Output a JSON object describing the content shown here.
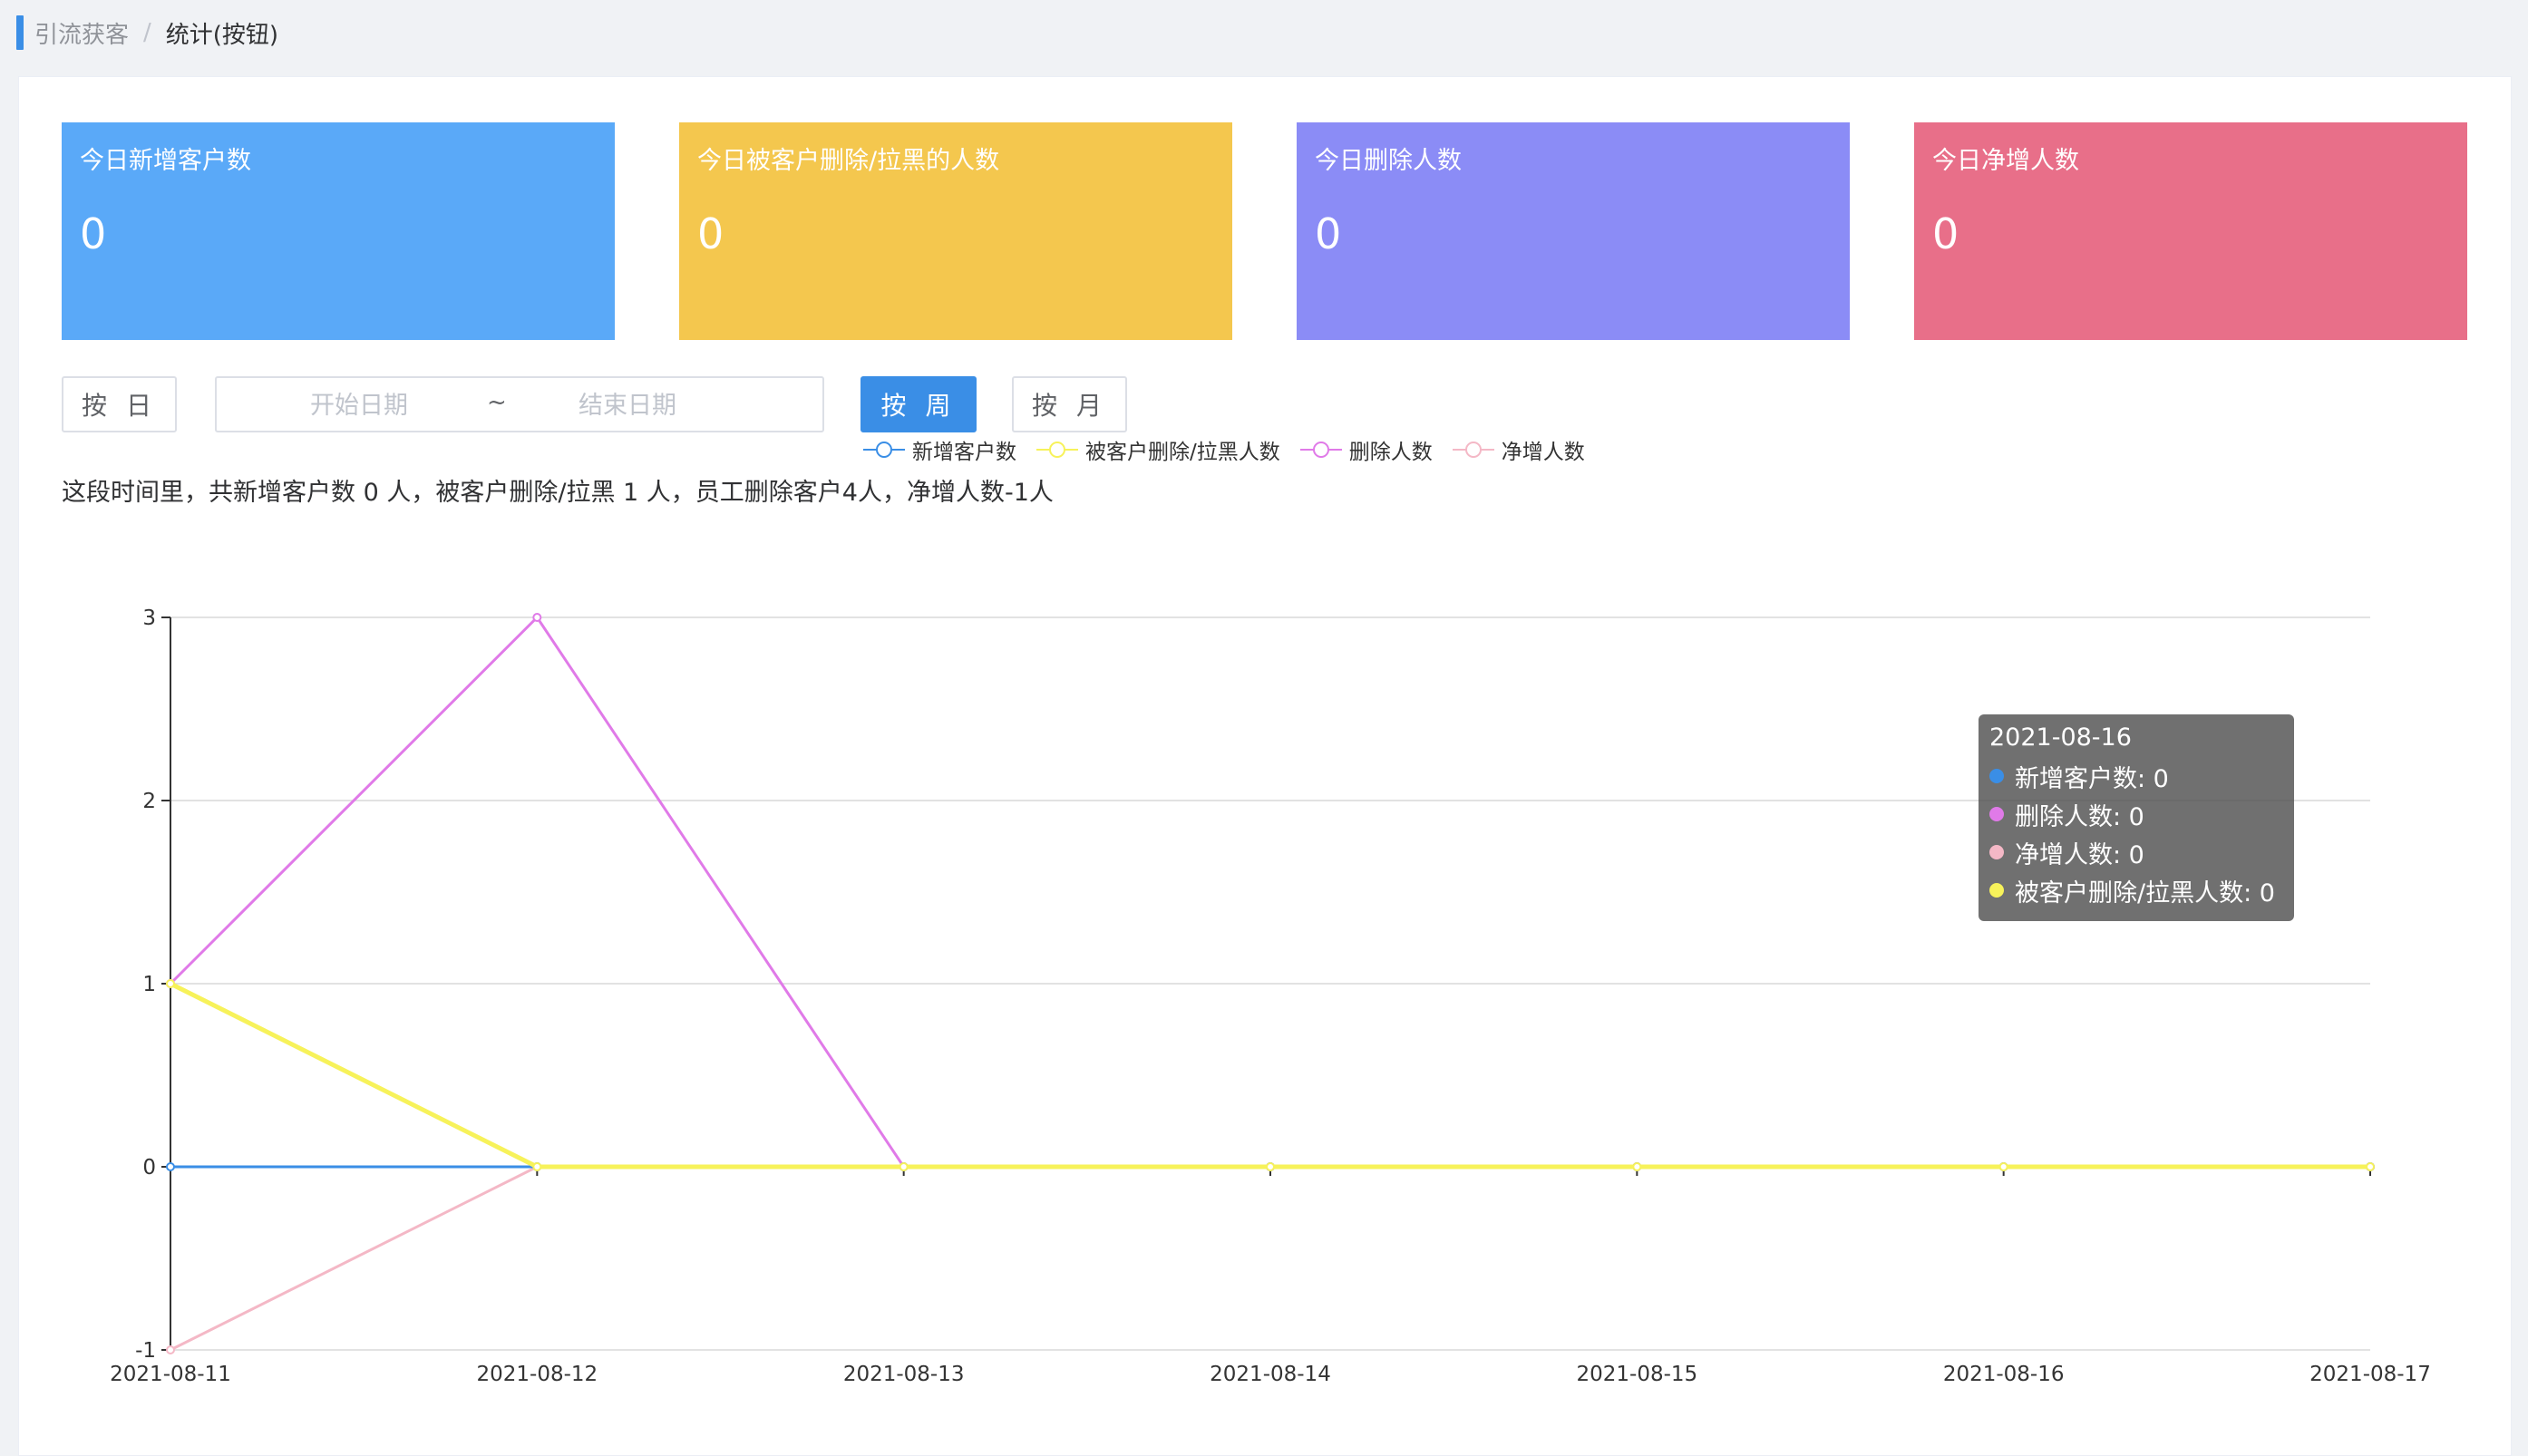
{
  "breadcrumb": {
    "root": "引流获客",
    "separator": "/",
    "current": "统计(按钮)"
  },
  "cards": [
    {
      "title": "今日新增客户数",
      "value": "0",
      "color": "#5aa9f8"
    },
    {
      "title": "今日被客户删除/拉黑的人数",
      "value": "0",
      "color": "#f4c74e"
    },
    {
      "title": "今日删除人数",
      "value": "0",
      "color": "#8b8cf6"
    },
    {
      "title": "今日净增人数",
      "value": "0",
      "color": "#e86f89"
    }
  ],
  "filters": {
    "day_label": "按 日",
    "week_label": "按 周",
    "month_label": "按 月",
    "start_placeholder": "开始日期",
    "range_separator": "~",
    "end_placeholder": "结束日期",
    "active": "week"
  },
  "summary": "这段时间里，共新增客户数 0 人，被客户删除/拉黑 1 人，员工删除客户4人，净增人数-1人",
  "chart_data": {
    "type": "line",
    "x": [
      "2021-08-11",
      "2021-08-12",
      "2021-08-13",
      "2021-08-14",
      "2021-08-15",
      "2021-08-16",
      "2021-08-17"
    ],
    "ylim": [
      -1,
      3
    ],
    "yticks": [
      "-1",
      "0",
      "1",
      "2",
      "3"
    ],
    "grid": true,
    "legend_position": "top",
    "series": [
      {
        "name": "新增客户数",
        "color": "#3a8ee6",
        "values": [
          0,
          0,
          0,
          0,
          0,
          0,
          0
        ]
      },
      {
        "name": "被客户删除/拉黑人数",
        "color": "#f7f25a",
        "values": [
          1,
          0,
          0,
          0,
          0,
          0,
          0
        ]
      },
      {
        "name": "删除人数",
        "color": "#e07ae8",
        "values": [
          1,
          3,
          0,
          0,
          0,
          0,
          0
        ]
      },
      {
        "name": "净增人数",
        "color": "#f4b8c6",
        "values": [
          -1,
          0,
          0,
          0,
          0,
          0,
          0
        ]
      }
    ]
  },
  "tooltip": {
    "date": "2021-08-16",
    "rows": [
      {
        "text": "新增客户数: 0",
        "color": "#3a8ee6"
      },
      {
        "text": "删除人数: 0",
        "color": "#e07ae8"
      },
      {
        "text": "净增人数: 0",
        "color": "#f4b8c6"
      },
      {
        "text": "被客户删除/拉黑人数: 0",
        "color": "#f7f25a"
      }
    ]
  }
}
